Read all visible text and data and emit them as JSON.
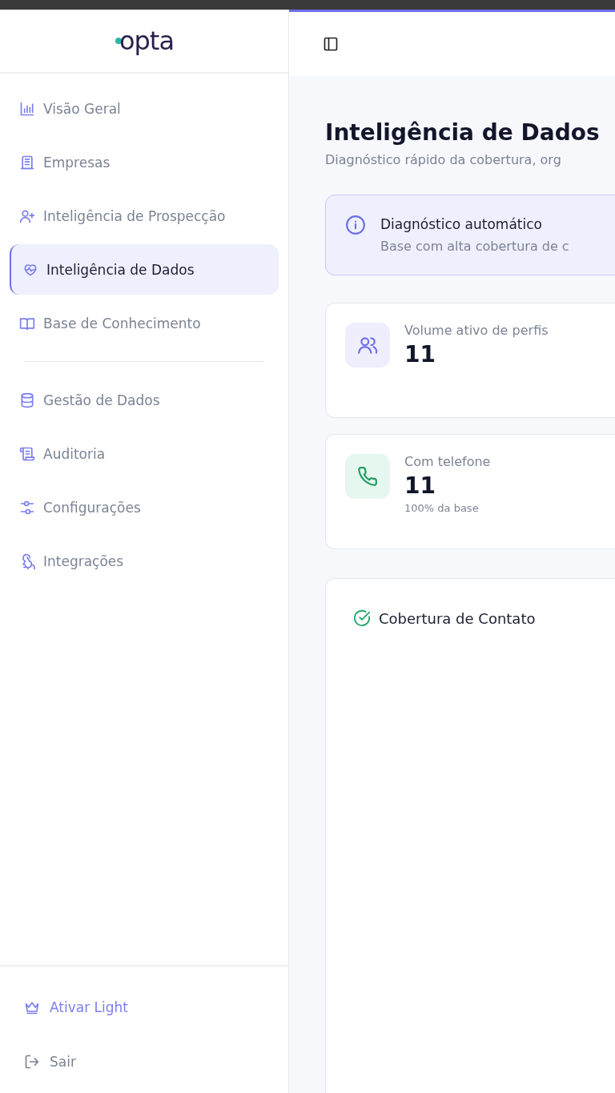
{
  "logo": {
    "text": "opta"
  },
  "sidebar": {
    "groups": [
      [
        {
          "label": "Visão Geral",
          "selected": false
        },
        {
          "label": "Empresas",
          "selected": false
        },
        {
          "label": "Inteligência de Prospecção",
          "selected": false
        },
        {
          "label": "Inteligência de Dados",
          "selected": true
        },
        {
          "label": "Base de Conhecimento",
          "selected": false
        }
      ],
      [
        {
          "label": "Gestão de Dados",
          "selected": false
        },
        {
          "label": "Auditoria",
          "selected": false
        },
        {
          "label": "Configurações",
          "selected": false
        },
        {
          "label": "Integrações",
          "selected": false
        }
      ]
    ],
    "footer": [
      {
        "label": "Ativar Light",
        "kind": "upgrade"
      },
      {
        "label": "Sair",
        "kind": "logout"
      }
    ]
  },
  "page": {
    "title": "Inteligência de Dados",
    "subtitle": "Diagnóstico rápido da cobertura, org"
  },
  "alert": {
    "title": "Diagnóstico automático",
    "text": "Base com alta cobertura de c"
  },
  "stats": [
    {
      "kind": "profiles",
      "label": "Volume ativo de perfis",
      "value": "11"
    },
    {
      "kind": "phone",
      "label": "Com telefone",
      "value": "11",
      "note": "100% da base"
    }
  ],
  "section": {
    "title": "Cobertura de Contato"
  }
}
